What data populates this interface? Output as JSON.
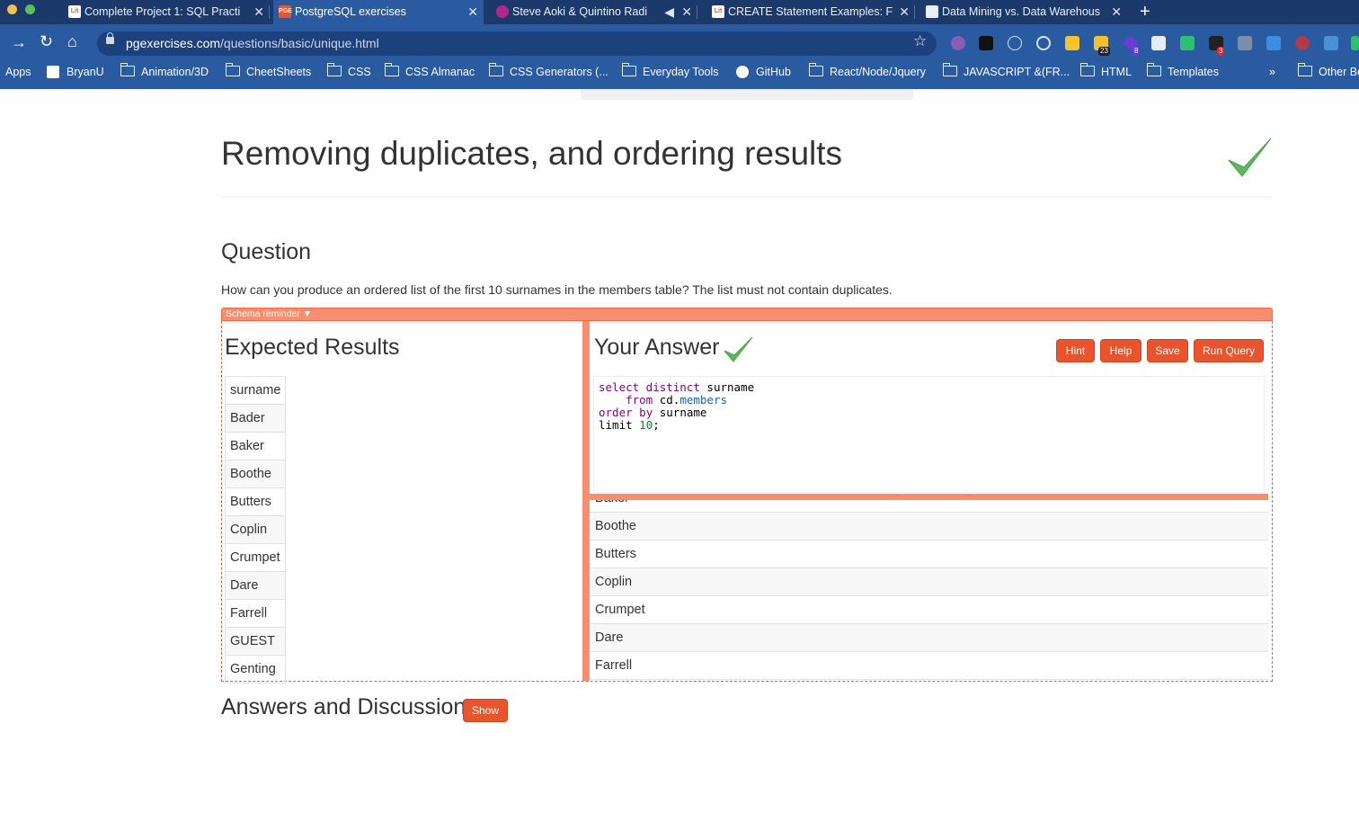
{
  "browser": {
    "tabs": [
      {
        "title": "Complete Project 1: SQL Practi",
        "favicon": "Lit",
        "active": false
      },
      {
        "title": "PostgreSQL exercises",
        "favicon": "PGE",
        "active": true
      },
      {
        "title": "Steve Aoki & Quintino Radi",
        "favicon": "player",
        "active": false
      },
      {
        "title": "CREATE Statement Examples: F",
        "favicon": "Lit",
        "active": false
      },
      {
        "title": "Data Mining vs. Data Warehous",
        "favicon": "page",
        "active": false
      }
    ],
    "url_host": "pgexercises.com",
    "url_path": "/questions/basic/unique.html",
    "extension_badges": [
      "23",
      "8",
      "3"
    ],
    "bookmarks": [
      "Apps",
      "BryanU",
      "Animation/3D",
      "CheetSheets",
      "CSS",
      "CSS Almanac",
      "CSS Generators (...",
      "Everyday  Tools",
      "GitHub",
      "React/Node/Jquery",
      "JAVASCRIPT &(FR...",
      "HTML",
      "Templates",
      "»",
      "Other Bo"
    ]
  },
  "page": {
    "title": "Removing duplicates, and ordering results",
    "question_heading": "Question",
    "question_text": "How can you produce an ordered list of the first 10 surnames in the members table? The list must not contain duplicates.",
    "schema_reminder": "Schema reminder ▼",
    "expected_heading": "Expected Results",
    "expected_header": "surname",
    "expected_rows": [
      "Bader",
      "Baker",
      "Boothe",
      "Butters",
      "Coplin",
      "Crumpet",
      "Dare",
      "Farrell",
      "GUEST",
      "Genting"
    ],
    "answer_heading": "Your Answer",
    "buttons": {
      "hint": "Hint",
      "help": "Help",
      "save": "Save",
      "run": "Run Query",
      "show": "Show"
    },
    "query": {
      "l1_kw": "select distinct",
      "l1_rest": " surname",
      "l2_indent": "    ",
      "l2_kw": "from",
      "l2_rest": " cd.",
      "l2_table": "members",
      "l3_kw1": "order",
      "l3_kw2": "by",
      "l3_rest": " surname",
      "l4_kw": "limit",
      "l4_num": "10",
      "l4_end": ";"
    },
    "result_rows": [
      "Baker",
      "Boothe",
      "Butters",
      "Coplin",
      "Crumpet",
      "Dare",
      "Farrell"
    ],
    "discussion_heading": "Answers and Discussion"
  },
  "colors": {
    "accent": "#e8542d",
    "splitter": "#f88d6f",
    "check": "#5cb85c",
    "chrome": "#2a5aa0"
  }
}
